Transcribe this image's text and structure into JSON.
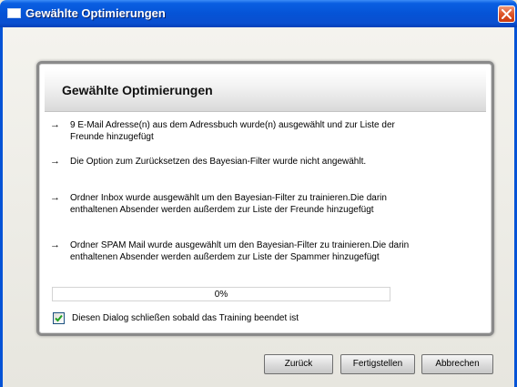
{
  "window": {
    "title": "Gewählte Optimierungen",
    "title_icon": "app-window-icon",
    "close_icon": "close-icon"
  },
  "panel": {
    "heading": "Gewählte Optimierungen",
    "items": [
      {
        "arrow": "→",
        "text": "9 E-Mail Adresse(n) aus dem Adressbuch wurde(n) ausgewählt und zur Liste der Freunde hinzugefügt"
      },
      {
        "arrow": "→",
        "text": "Die Option zum Zurücksetzen des Bayesian-Filter wurde nicht angewählt."
      },
      {
        "arrow": "→",
        "text": "Ordner Inbox wurde ausgewählt um den Bayesian-Filter zu trainieren.Die darin enthaltenen Absender werden außerdem zur Liste der Freunde hinzugefügt"
      },
      {
        "arrow": "→",
        "text": "Ordner SPAM Mail wurde ausgewählt um den Bayesian-Filter zu trainieren.Die darin enthaltenen Absender werden außerdem zur Liste der Spammer hinzugefügt"
      }
    ],
    "progress": {
      "value": 0,
      "label": "0%"
    },
    "close_checkbox": {
      "checked": true,
      "label": "Diesen Dialog schließen sobald das Training beendet ist"
    }
  },
  "buttons": {
    "back": "Zurück",
    "finish": "Fertigstellen",
    "cancel": "Abbrechen"
  },
  "colors": {
    "titlebar": "#0553d6",
    "close_button": "#e05a2e",
    "dialog_background": "#ece9d8",
    "progress_fill": "#3c9b3c"
  }
}
